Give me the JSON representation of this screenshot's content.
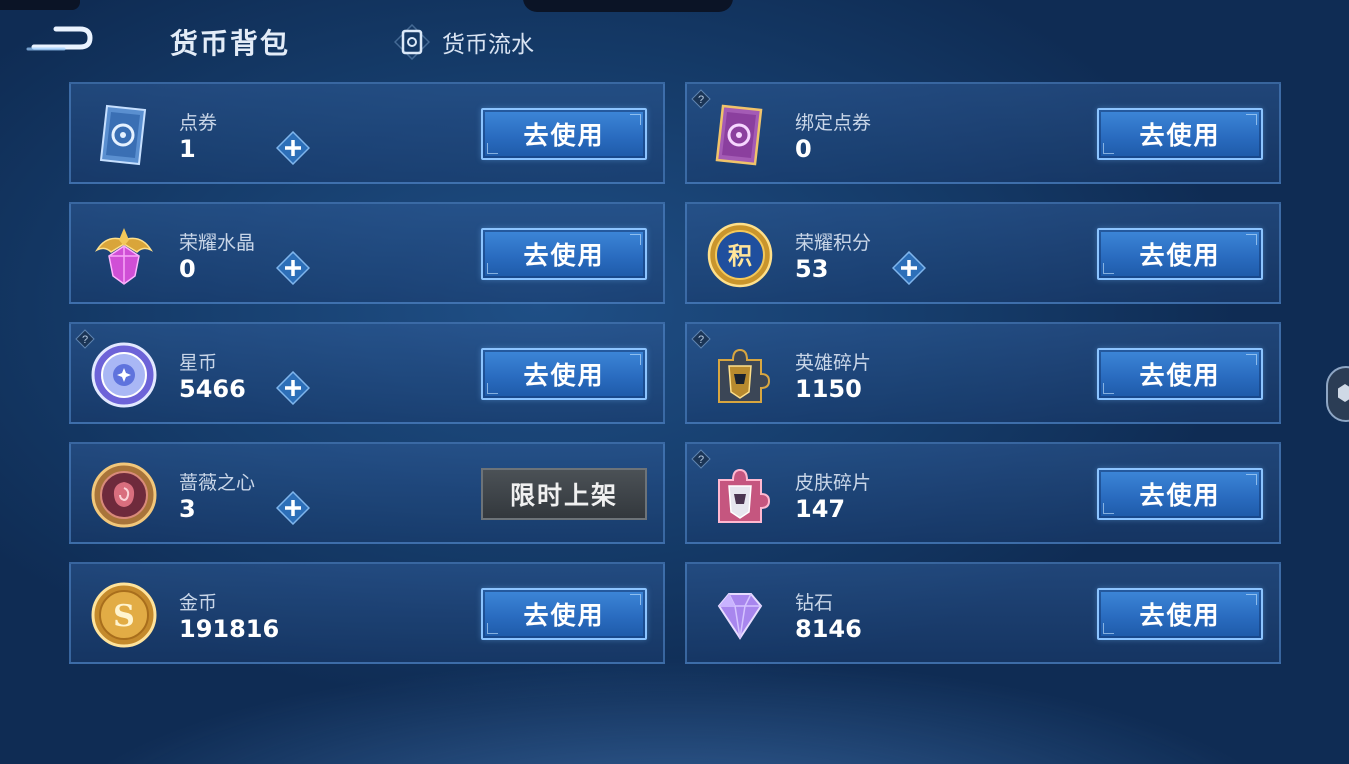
{
  "header": {
    "title": "货币背包",
    "flow_link": "货币流水"
  },
  "cards": [
    {
      "name": "点券",
      "value": "1",
      "action": "去使用",
      "has_plus": true,
      "has_help": false,
      "icon": "coupon-card-icon"
    },
    {
      "name": "绑定点券",
      "value": "0",
      "action": "去使用",
      "has_plus": false,
      "has_help": true,
      "icon": "bound-coupon-card-icon"
    },
    {
      "name": "荣耀水晶",
      "value": "0",
      "action": "去使用",
      "has_plus": true,
      "has_help": false,
      "icon": "glory-crystal-icon"
    },
    {
      "name": "荣耀积分",
      "value": "53",
      "action": "去使用",
      "has_plus": true,
      "has_help": false,
      "icon": "glory-points-icon"
    },
    {
      "name": "星币",
      "value": "5466",
      "action": "去使用",
      "has_plus": true,
      "has_help": true,
      "icon": "star-coin-icon"
    },
    {
      "name": "英雄碎片",
      "value": "1150",
      "action": "去使用",
      "has_plus": false,
      "has_help": true,
      "icon": "hero-fragment-icon"
    },
    {
      "name": "蔷薇之心",
      "value": "3",
      "action": "限时上架",
      "has_plus": true,
      "has_help": false,
      "icon": "rose-heart-icon"
    },
    {
      "name": "皮肤碎片",
      "value": "147",
      "action": "去使用",
      "has_plus": false,
      "has_help": true,
      "icon": "skin-fragment-icon"
    },
    {
      "name": "金币",
      "value": "191816",
      "action": "去使用",
      "has_plus": false,
      "has_help": false,
      "icon": "gold-coin-icon"
    },
    {
      "name": "钻石",
      "value": "8146",
      "action": "去使用",
      "has_plus": false,
      "has_help": false,
      "icon": "diamond-icon"
    }
  ],
  "colors": {
    "accent": "#3d87d8",
    "disabled": "#3f4449"
  }
}
